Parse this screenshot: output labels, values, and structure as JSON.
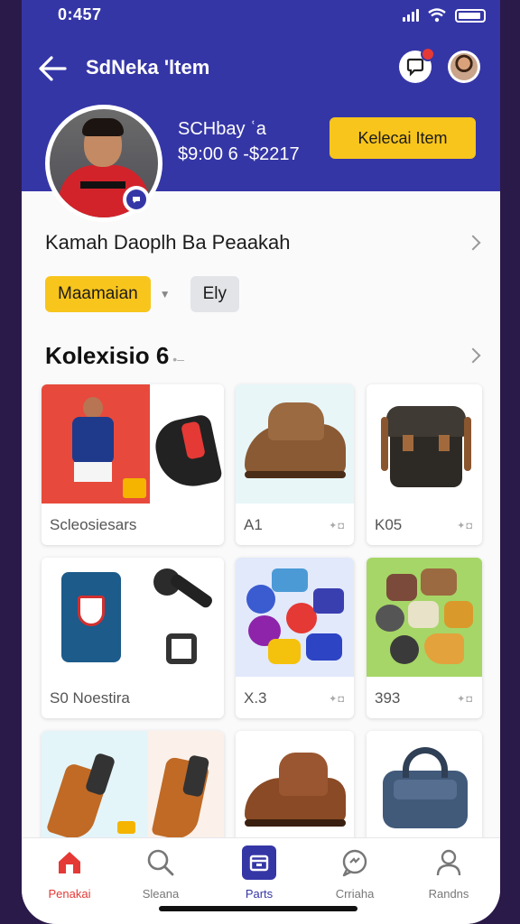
{
  "status": {
    "time": "0:457"
  },
  "header": {
    "title": "SdNeka 'ltem",
    "profile_name": "SCHbay ʿa",
    "price_range": "$9:00 6 -$2217",
    "collect_button": "Kelecai Item"
  },
  "info_row": {
    "label": "Kamah Daoplh Ba Peaakah"
  },
  "chips": {
    "primary": "Maamaian",
    "secondary": "Ely"
  },
  "collection": {
    "title": "Kolexisio",
    "count": "6",
    "items": [
      {
        "label": "Scleosiesars",
        "meta": ""
      },
      {
        "label": "A1",
        "meta": "✦◘"
      },
      {
        "label": "K05",
        "meta": "✦◘"
      },
      {
        "label": "S0 Noestira",
        "meta": ""
      },
      {
        "label": "X.3",
        "meta": "✦◘"
      },
      {
        "label": "393",
        "meta": "✦◘"
      },
      {
        "label": "",
        "meta": ""
      },
      {
        "label": "",
        "meta": ""
      },
      {
        "label": "",
        "meta": ""
      }
    ]
  },
  "bottom_nav": [
    {
      "label": "Penakai",
      "active": true
    },
    {
      "label": "Sleana"
    },
    {
      "label": "Parts"
    },
    {
      "label": "Crriaha"
    },
    {
      "label": "Randns"
    }
  ],
  "colors": {
    "brand": "#3536a6",
    "accent": "#f8c51c",
    "active_nav": "#e53935"
  }
}
